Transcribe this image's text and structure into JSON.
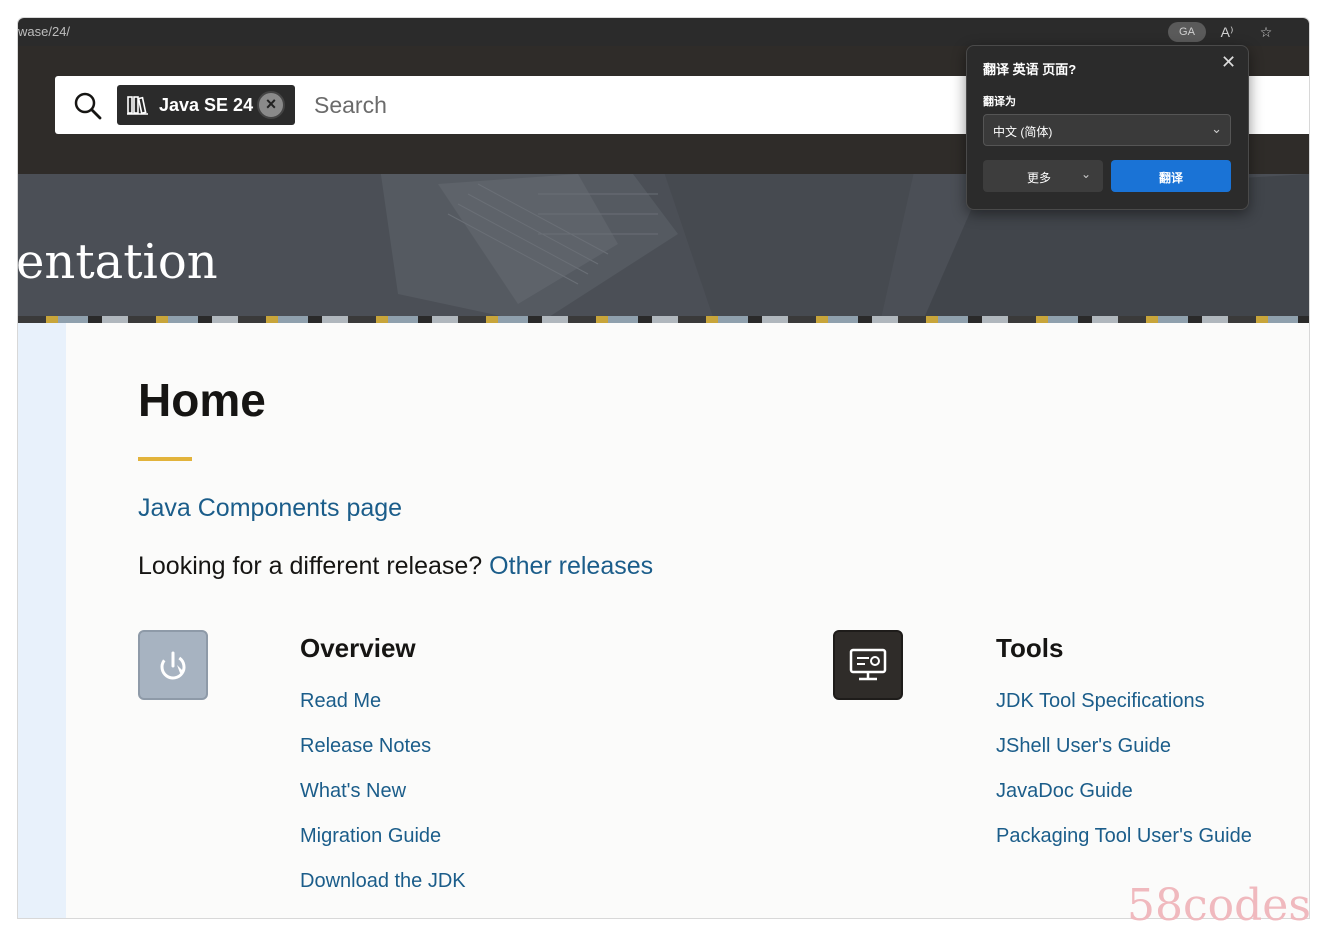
{
  "browser": {
    "url_fragment": "wase/24/",
    "translate_pill": "GA",
    "reader_icon": "read-aloud-icon",
    "favorite_icon": "star-icon"
  },
  "search": {
    "chip_label": "Java SE 24",
    "placeholder": "Search"
  },
  "banner": {
    "title_fragment": "entation"
  },
  "main": {
    "heading": "Home",
    "components_link": "Java Components page",
    "looking_text": "Looking for a different release?",
    "other_releases_link": "Other releases",
    "sections": [
      {
        "title": "Overview",
        "icon": "power-icon",
        "links": [
          "Read Me",
          "Release Notes",
          "What's New",
          "Migration Guide",
          "Download the JDK"
        ]
      },
      {
        "title": "Tools",
        "icon": "monitor-tools-icon",
        "links": [
          "JDK Tool Specifications",
          "JShell User's Guide",
          "JavaDoc Guide",
          "Packaging Tool User's Guide"
        ]
      }
    ]
  },
  "translate_popup": {
    "title": "翻译 英语 页面?",
    "to_label": "翻译为",
    "language": "中文 (简体)",
    "more_label": "更多",
    "translate_label": "翻译"
  },
  "watermark": "58codes",
  "colors": {
    "accent_link": "#1b5d8a",
    "heading_underline": "#e2b33b",
    "translate_button": "#1a73d6"
  }
}
